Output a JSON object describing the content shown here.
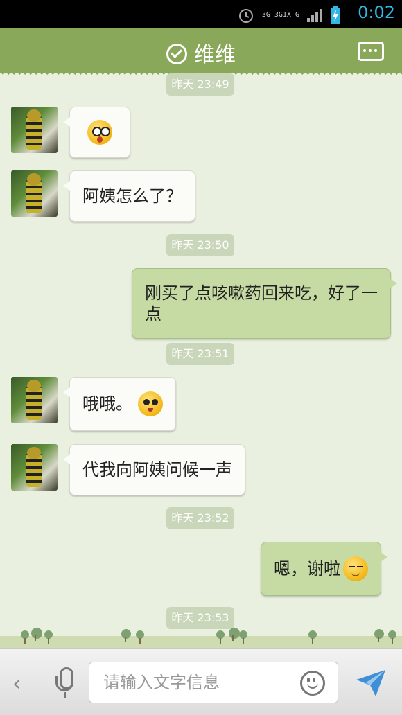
{
  "status_bar": {
    "time": "0:02",
    "signal_text_1": "3G 3G1X G",
    "icons": [
      "alarm-icon",
      "signal-icon",
      "battery-charging-icon"
    ]
  },
  "header": {
    "title": "维维",
    "icons": [
      "check-circle-icon",
      "more-menu-icon"
    ]
  },
  "messages": [
    {
      "type": "time",
      "text": "昨天 23:49"
    },
    {
      "type": "received",
      "text": "",
      "emoji": "shocked-emoji"
    },
    {
      "type": "received",
      "text": "阿姨怎么了？"
    },
    {
      "type": "time",
      "text": "昨天 23:50"
    },
    {
      "type": "sent",
      "text": "刚买了点咳嗽药回来吃，好了一点"
    },
    {
      "type": "time",
      "text": "昨天 23:51"
    },
    {
      "type": "received",
      "text": "哦哦。",
      "emoji": "pleading-emoji"
    },
    {
      "type": "received",
      "text": "代我向阿姨问候一声"
    },
    {
      "type": "time",
      "text": "昨天 23:52"
    },
    {
      "type": "sent",
      "text": "嗯，谢啦",
      "emoji": "content-emoji"
    },
    {
      "type": "time",
      "text": "昨天 23:53"
    }
  ],
  "input_bar": {
    "back_label": "‹",
    "placeholder": "请输入文字信息",
    "value": ""
  },
  "colors": {
    "header_green": "#8aa85a",
    "chat_bg": "#e9f0df",
    "sent_bubble": "#c6dba3",
    "received_bubble": "#fbfbf8",
    "time_accent": "#33b5e5"
  }
}
